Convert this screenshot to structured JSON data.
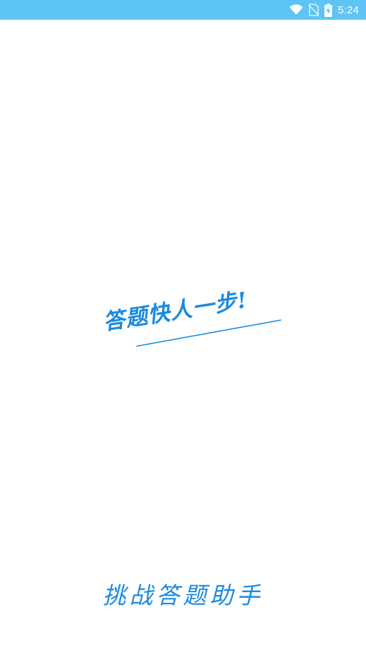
{
  "status_bar": {
    "time": "5:24",
    "icons": [
      "wifi-icon",
      "no-sim-icon",
      "battery-charging-icon"
    ],
    "background": "#5ec4f6"
  },
  "splash": {
    "slogan": "答题快人一步!",
    "app_name": "挑战答题助手",
    "accent_color": "#1a8ae0"
  }
}
